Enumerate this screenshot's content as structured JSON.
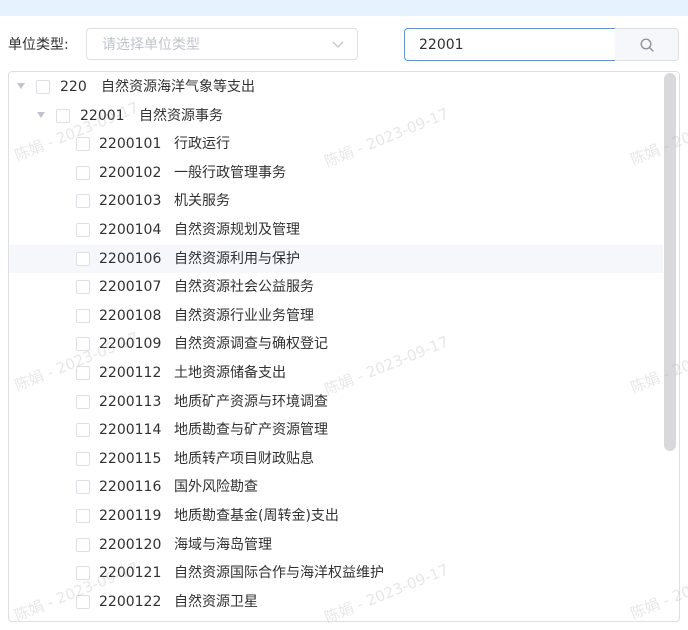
{
  "filter": {
    "label": "单位类型:",
    "placeholder": "请选择单位类型"
  },
  "search": {
    "value": "22001"
  },
  "tree": [
    {
      "code": "220",
      "name": "自然资源海洋气象等支出",
      "level": 0,
      "expanded": true
    },
    {
      "code": "22001",
      "name": "自然资源事务",
      "level": 1,
      "expanded": true
    },
    {
      "code": "2200101",
      "name": "行政运行",
      "level": 2
    },
    {
      "code": "2200102",
      "name": "一般行政管理事务",
      "level": 2
    },
    {
      "code": "2200103",
      "name": "机关服务",
      "level": 2
    },
    {
      "code": "2200104",
      "name": "自然资源规划及管理",
      "level": 2
    },
    {
      "code": "2200106",
      "name": "自然资源利用与保护",
      "level": 2,
      "highlighted": true
    },
    {
      "code": "2200107",
      "name": "自然资源社会公益服务",
      "level": 2
    },
    {
      "code": "2200108",
      "name": "自然资源行业业务管理",
      "level": 2
    },
    {
      "code": "2200109",
      "name": "自然资源调查与确权登记",
      "level": 2
    },
    {
      "code": "2200112",
      "name": "土地资源储备支出",
      "level": 2
    },
    {
      "code": "2200113",
      "name": "地质矿产资源与环境调查",
      "level": 2
    },
    {
      "code": "2200114",
      "name": "地质勘查与矿产资源管理",
      "level": 2
    },
    {
      "code": "2200115",
      "name": "地质转产项目财政贴息",
      "level": 2
    },
    {
      "code": "2200116",
      "name": "国外风险勘查",
      "level": 2
    },
    {
      "code": "2200119",
      "name": "地质勘查基金(周转金)支出",
      "level": 2
    },
    {
      "code": "2200120",
      "name": "海域与海岛管理",
      "level": 2
    },
    {
      "code": "2200121",
      "name": "自然资源国际合作与海洋权益维护",
      "level": 2
    },
    {
      "code": "2200122",
      "name": "自然资源卫星",
      "level": 2
    }
  ],
  "watermark": "陈娟 - 2023-09-17",
  "colors": {
    "accent": "#409eff",
    "border": "#dcdfe6",
    "highlight_row": "#f5f7fa",
    "topbar": "#e6f2fe"
  },
  "icons": {
    "search": "search-icon",
    "select_arrow": "chevron-down-icon",
    "expand": "caret-down-icon"
  }
}
